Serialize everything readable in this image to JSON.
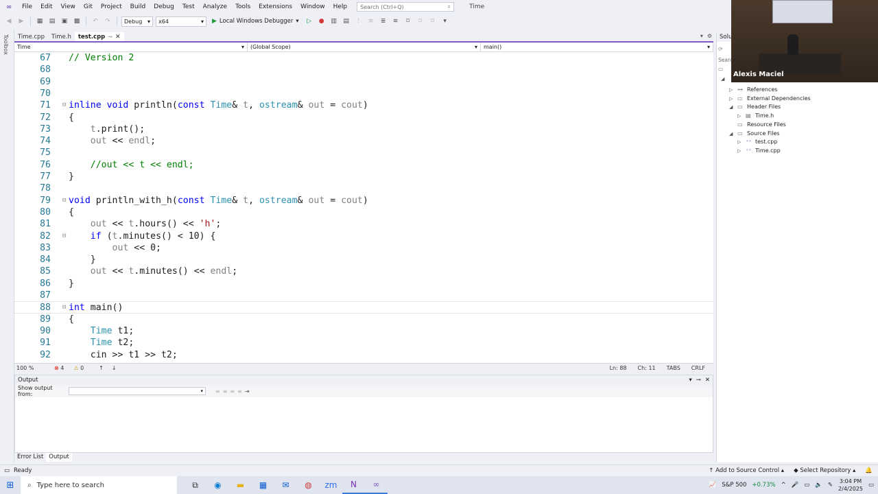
{
  "menu": {
    "items": [
      "File",
      "Edit",
      "View",
      "Git",
      "Project",
      "Build",
      "Debug",
      "Test",
      "Analyze",
      "Tools",
      "Extensions",
      "Window",
      "Help"
    ],
    "search_placeholder": "Search (Ctrl+Q)",
    "solution_name": "Time"
  },
  "toolbar": {
    "configuration": "Debug",
    "platform": "x64",
    "debugger": "Local Windows Debugger"
  },
  "toolbox_label": "Toolbox",
  "tabs": [
    {
      "label": "Time.cpp",
      "active": false
    },
    {
      "label": "Time.h",
      "active": false
    },
    {
      "label": "test.cpp",
      "active": true
    }
  ],
  "navbar": {
    "project": "Time",
    "scope": "(Global Scope)",
    "member": "main()"
  },
  "editor": {
    "current_line": 88,
    "lines": [
      {
        "n": "67",
        "code": "// Version 2"
      },
      {
        "n": "68",
        "code": ""
      },
      {
        "n": "69",
        "code": ""
      },
      {
        "n": "70",
        "code": ""
      },
      {
        "n": "71",
        "code": "inline void println(const Time& t, ostream& out = cout)"
      },
      {
        "n": "72",
        "code": "{"
      },
      {
        "n": "73",
        "code": "    t.print();"
      },
      {
        "n": "74",
        "code": "    out << endl;"
      },
      {
        "n": "75",
        "code": ""
      },
      {
        "n": "76",
        "code": "    //out << t << endl;"
      },
      {
        "n": "77",
        "code": "}"
      },
      {
        "n": "78",
        "code": ""
      },
      {
        "n": "79",
        "code": "void println_with_h(const Time& t, ostream& out = cout)"
      },
      {
        "n": "80",
        "code": "{"
      },
      {
        "n": "81",
        "code": "    out << t.hours() << 'h';"
      },
      {
        "n": "82",
        "code": "    if (t.minutes() < 10) {"
      },
      {
        "n": "83",
        "code": "        out << 0;"
      },
      {
        "n": "84",
        "code": "    }"
      },
      {
        "n": "85",
        "code": "    out << t.minutes() << endl;"
      },
      {
        "n": "86",
        "code": "}"
      },
      {
        "n": "87",
        "code": ""
      },
      {
        "n": "88",
        "code": "int main()"
      },
      {
        "n": "89",
        "code": "{"
      },
      {
        "n": "90",
        "code": "    Time t1;"
      },
      {
        "n": "91",
        "code": "    Time t2;"
      },
      {
        "n": "92",
        "code": "    cin >> t1 >> t2;"
      }
    ]
  },
  "editor_status": {
    "zoom": "100 %",
    "errors": "4",
    "warnings": "0",
    "position": "Ln: 88",
    "column": "Ch: 11",
    "indent": "TABS",
    "line_ending": "CRLF"
  },
  "output": {
    "title": "Output",
    "show_from_label": "Show output from:",
    "show_from_value": ""
  },
  "bottom_tabs": [
    "Error List",
    "Output"
  ],
  "solution_explorer": {
    "title": "Soluti",
    "search_placeholder": "Searc",
    "items": [
      {
        "label": "References",
        "icon": "references-icon",
        "arrow": "▷",
        "level": 1
      },
      {
        "label": "External Dependencies",
        "icon": "folder-icon",
        "arrow": "▷",
        "level": 1
      },
      {
        "label": "Header Files",
        "icon": "folder-icon",
        "arrow": "◢",
        "level": 1
      },
      {
        "label": "Time.h",
        "icon": "header-file-icon",
        "arrow": "▷",
        "level": 2
      },
      {
        "label": "Resource Files",
        "icon": "folder-icon",
        "arrow": "",
        "level": 1
      },
      {
        "label": "Source Files",
        "icon": "folder-icon",
        "arrow": "◢",
        "level": 1
      },
      {
        "label": "test.cpp",
        "icon": "cpp-file-icon",
        "arrow": "▷",
        "level": 2
      },
      {
        "label": "Time.cpp",
        "icon": "cpp-file-icon",
        "arrow": "▷",
        "level": 2
      }
    ]
  },
  "webcam": {
    "name": "Alexis Maciel"
  },
  "statusbar": {
    "ready": "Ready",
    "source_control": "Add to Source Control",
    "repository": "Select Repository"
  },
  "taskbar": {
    "search_placeholder": "Type here to search",
    "stock_name": "S&P 500",
    "stock_change": "+0.73%",
    "time": "3:04 PM",
    "date": "2/4/2025",
    "apps": [
      "task-view-icon",
      "edge-icon",
      "file-explorer-icon",
      "store-icon",
      "mail-icon",
      "chrome-icon",
      "zoom-icon",
      "onenote-icon",
      "visual-studio-icon"
    ]
  }
}
